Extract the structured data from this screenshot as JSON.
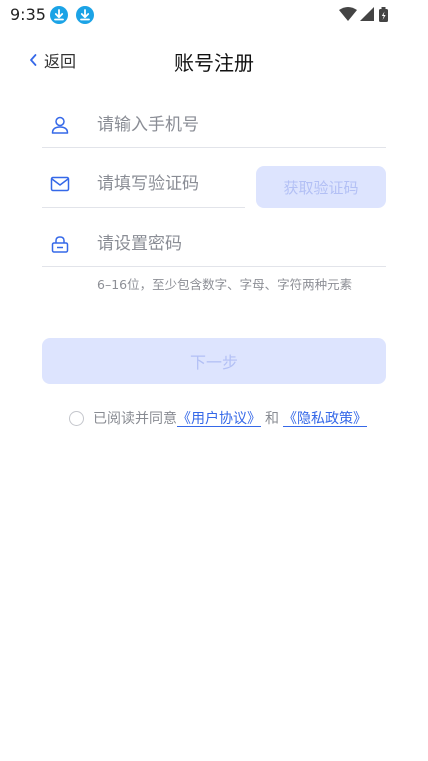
{
  "status_bar": {
    "time": "9:35"
  },
  "nav": {
    "back_label": "返回",
    "title": "账号注册"
  },
  "form": {
    "phone": {
      "placeholder": "请输入手机号",
      "value": ""
    },
    "code": {
      "placeholder": "请填写验证码",
      "value": ""
    },
    "password": {
      "placeholder": "请设置密码",
      "value": ""
    },
    "get_code_label": "获取验证码",
    "password_hint": "6–16位，至少包含数字、字母、字符两种元素",
    "next_label": "下一步"
  },
  "agreement": {
    "prefix": "已阅读并同意",
    "user_agreement": "《用户协议》",
    "and": "和",
    "privacy_policy": "《隐私政策》",
    "checked": false
  },
  "colors": {
    "accent": "#3568e8",
    "button_disabled_bg": "#dde4fe",
    "button_disabled_text": "#b3c0f5"
  }
}
